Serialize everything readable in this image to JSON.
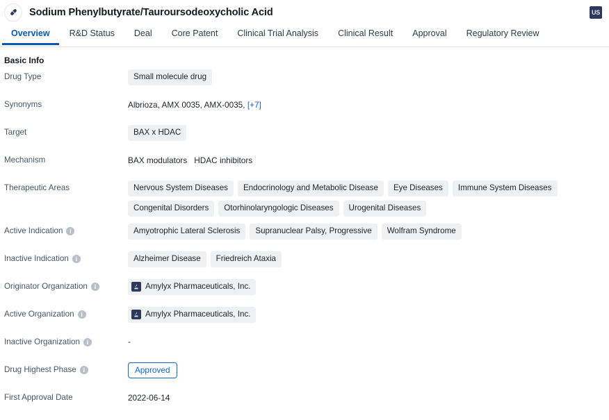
{
  "header": {
    "drug_icon": "pill-capsule-icon",
    "title": "Sodium Phenylbutyrate/Tauroursodeoxycholic Acid",
    "region_badge": "US"
  },
  "tabs": [
    {
      "label": "Overview",
      "active": true
    },
    {
      "label": "R&D Status",
      "active": false
    },
    {
      "label": "Deal",
      "active": false
    },
    {
      "label": "Core Patent",
      "active": false
    },
    {
      "label": "Clinical Trial Analysis",
      "active": false
    },
    {
      "label": "Clinical Result",
      "active": false
    },
    {
      "label": "Approval",
      "active": false
    },
    {
      "label": "Regulatory Review",
      "active": false
    }
  ],
  "section": {
    "title": "Basic Info"
  },
  "rows": {
    "drug_type": {
      "label": "Drug Type",
      "tags": [
        "Small molecule drug"
      ]
    },
    "synonyms": {
      "label": "Synonyms",
      "text": "Albrioza,  AMX 0035,  AMX-0035,",
      "more_link": "[+7]"
    },
    "target": {
      "label": "Target",
      "tags": [
        "BAX x HDAC"
      ]
    },
    "mechanism": {
      "label": "Mechanism",
      "items": [
        "BAX modulators",
        "HDAC inhibitors"
      ]
    },
    "therapeutic_areas": {
      "label": "Therapeutic Areas",
      "tags": [
        "Nervous System Diseases",
        "Endocrinology and Metabolic Disease",
        "Eye Diseases",
        "Immune System Diseases",
        "Congenital Disorders",
        "Otorhinolaryngologic Diseases",
        "Urogenital Diseases"
      ]
    },
    "active_indication": {
      "label": "Active Indication",
      "has_info": true,
      "tags": [
        "Amyotrophic Lateral Sclerosis",
        "Supranuclear Palsy, Progressive",
        "Wolfram Syndrome"
      ]
    },
    "inactive_indication": {
      "label": "Inactive Indication",
      "has_info": true,
      "tags": [
        "Alzheimer Disease",
        "Friedreich Ataxia"
      ]
    },
    "originator_organization": {
      "label": "Originator Organization",
      "has_info": true,
      "orgs": [
        "Amylyx Pharmaceuticals, Inc."
      ]
    },
    "active_organization": {
      "label": "Active Organization",
      "has_info": true,
      "orgs": [
        "Amylyx Pharmaceuticals, Inc."
      ]
    },
    "inactive_organization": {
      "label": "Inactive Organization",
      "has_info": true,
      "value": "-"
    },
    "drug_highest_phase": {
      "label": "Drug Highest Phase",
      "has_info": true,
      "phase": "Approved"
    },
    "first_approval_date": {
      "label": "First Approval Date",
      "value": "2022-06-14"
    }
  },
  "colors": {
    "accent_blue": "#0b57b8",
    "link_blue": "#1464cc",
    "tag_bg": "#eff0f2",
    "label_gray": "#4a5567",
    "badge_navy": "#2b3a5c"
  }
}
